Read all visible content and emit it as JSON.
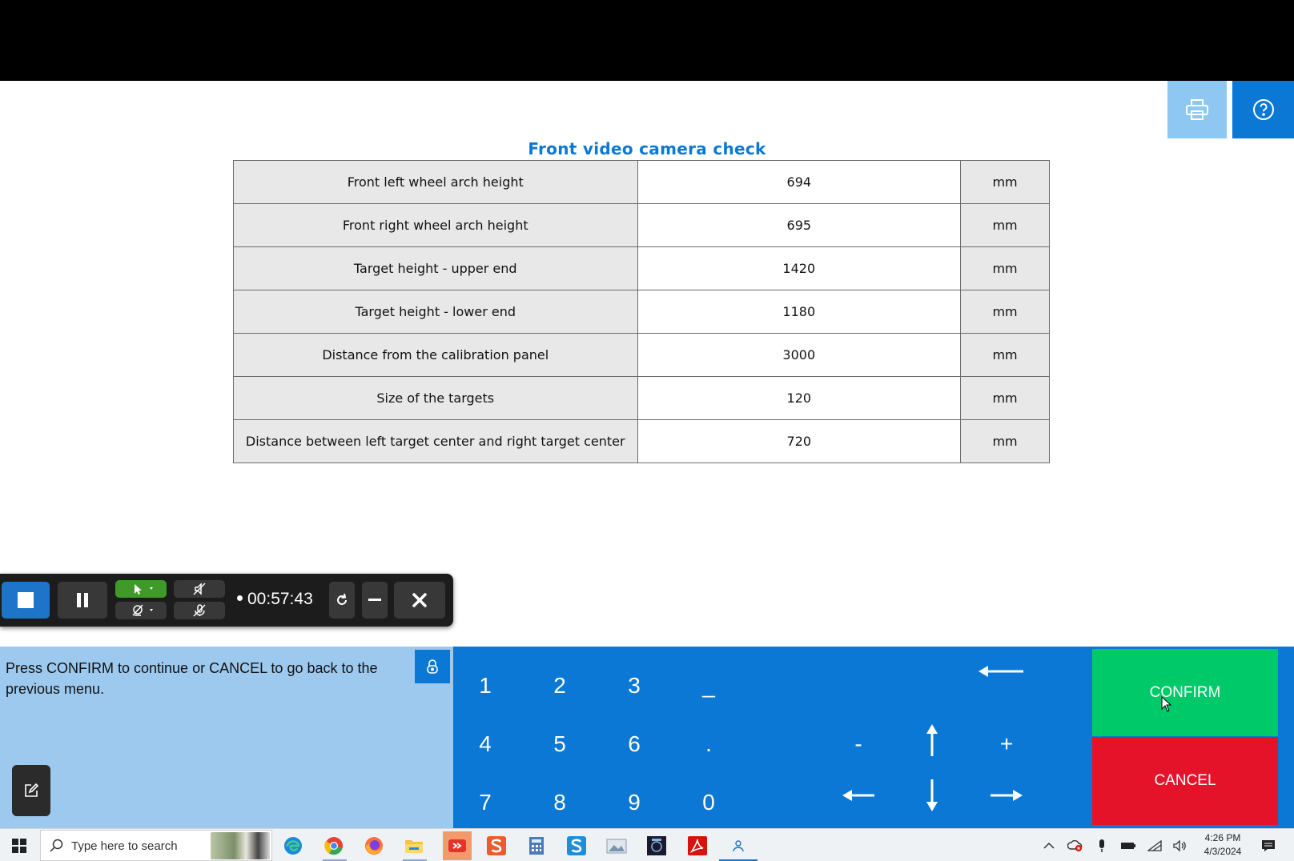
{
  "header": {
    "print_icon": "printer-icon",
    "help_icon": "question-mark-icon"
  },
  "page": {
    "title": "Front video camera check"
  },
  "table": {
    "rows": [
      {
        "label": "Front left wheel arch height",
        "value": "694",
        "unit": "mm"
      },
      {
        "label": "Front right wheel arch height",
        "value": "695",
        "unit": "mm"
      },
      {
        "label": "Target height - upper end",
        "value": "1420",
        "unit": "mm"
      },
      {
        "label": "Target height - lower end",
        "value": "1180",
        "unit": "mm"
      },
      {
        "label": "Distance from the calibration panel",
        "value": "3000",
        "unit": "mm"
      },
      {
        "label": "Size of the targets",
        "value": "120",
        "unit": "mm"
      },
      {
        "label": "Distance between left target center and right target center",
        "value": "720",
        "unit": "mm"
      }
    ]
  },
  "recorder": {
    "time": "00:57:43"
  },
  "message": {
    "text": "Press CONFIRM to continue or CANCEL to go back to the previous menu."
  },
  "keypad": {
    "keys": [
      "1",
      "2",
      "3",
      "_",
      "4",
      "5",
      "6",
      ".",
      "7",
      "8",
      "9",
      "0"
    ],
    "minus": "-",
    "plus": "+"
  },
  "actions": {
    "confirm": "CONFIRM",
    "cancel": "CANCEL"
  },
  "taskbar": {
    "search_placeholder": "Type here to search",
    "time": "4:26 PM",
    "date": "4/3/2024"
  },
  "colors": {
    "accent": "#0a78d4",
    "confirm": "#00c96a",
    "cancel": "#e5132a",
    "message_bg": "#9ec9ef"
  }
}
